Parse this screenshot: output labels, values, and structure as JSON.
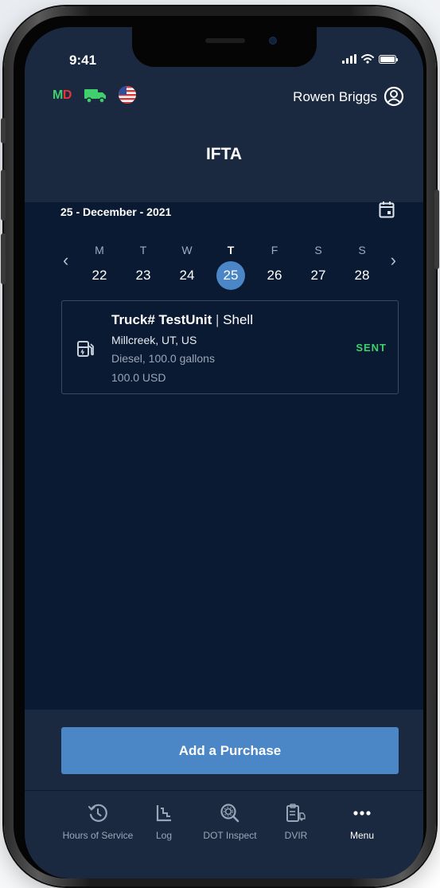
{
  "status_bar": {
    "time": "9:41"
  },
  "header": {
    "md_m": "M",
    "md_d": "D",
    "user_name": "Rowen Briggs",
    "title": "IFTA",
    "icons": [
      "truck-icon",
      "us-flag-icon",
      "user-circle-icon"
    ]
  },
  "date_picker": {
    "current_date": "25 - December - 2021",
    "days": [
      {
        "weekday": "M",
        "date": "22",
        "selected": false
      },
      {
        "weekday": "T",
        "date": "23",
        "selected": false
      },
      {
        "weekday": "W",
        "date": "24",
        "selected": false
      },
      {
        "weekday": "T",
        "date": "25",
        "selected": true
      },
      {
        "weekday": "F",
        "date": "26",
        "selected": false
      },
      {
        "weekday": "S",
        "date": "27",
        "selected": false
      },
      {
        "weekday": "S",
        "date": "28",
        "selected": false
      }
    ],
    "prev_label": "‹",
    "next_label": "›"
  },
  "purchases": [
    {
      "truck": "Truck# TestUnit",
      "separator": "|",
      "vendor": "Shell",
      "location": "Millcreek, UT, US",
      "fuel": "Diesel, 100.0 gallons",
      "amount": "100.0 USD",
      "status": "SENT"
    }
  ],
  "actions": {
    "add_purchase_label": "Add a Purchase"
  },
  "tabs": [
    {
      "label": "Hours of Service",
      "icon": "clock-history-icon"
    },
    {
      "label": "Log",
      "icon": "log-chart-icon"
    },
    {
      "label": "DOT Inspect",
      "icon": "inspect-search-icon"
    },
    {
      "label": "DVIR",
      "icon": "dvir-clipboard-icon"
    },
    {
      "label": "Menu",
      "icon": "more-dots-icon"
    }
  ],
  "colors": {
    "background": "#0b1a33",
    "header": "#1a2940",
    "accent": "#4b86c6",
    "success": "#3fcf6c",
    "danger": "#e5343a"
  }
}
